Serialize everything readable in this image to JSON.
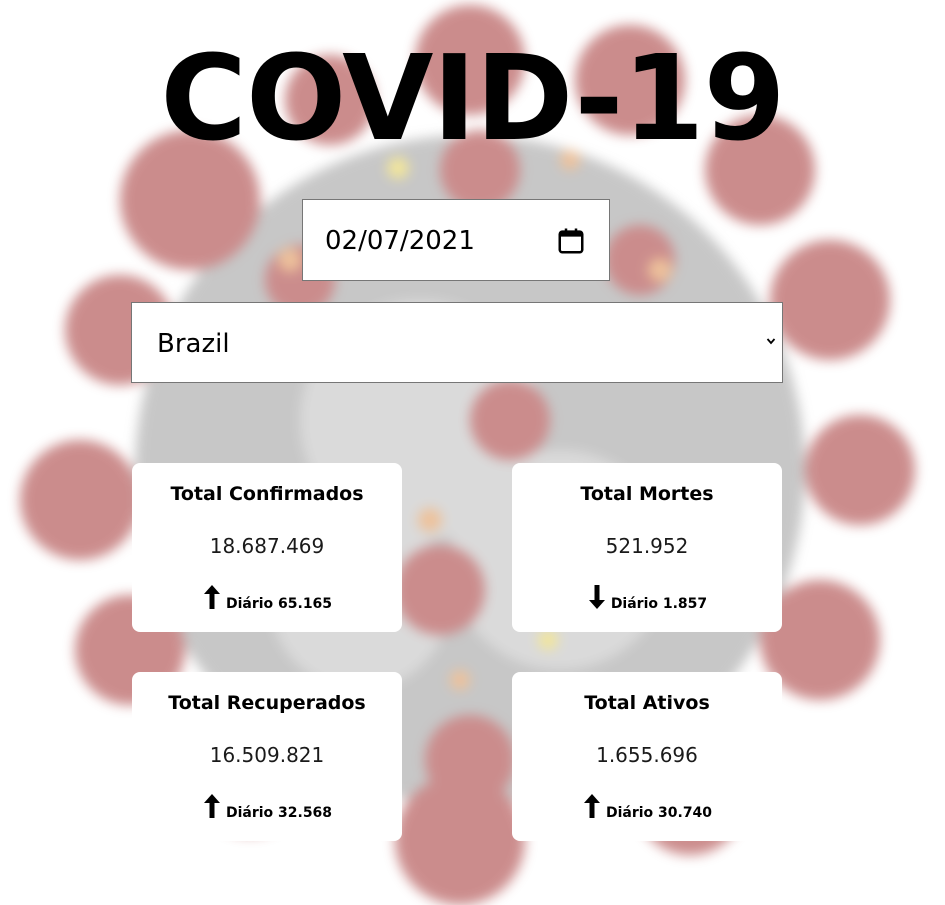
{
  "header": {
    "title": "COVID-19"
  },
  "filters": {
    "date_value": "02/07/2021",
    "country_value": "Brazil"
  },
  "icons": {
    "calendar": "calendar-icon",
    "dropdown": "chevron-down-icon",
    "up": "arrow-up-icon",
    "down": "arrow-down-icon"
  },
  "colors": {
    "card_bg": "#ffffff",
    "text": "#000000",
    "virus_red": "#b13a3a",
    "virus_gray": "#a9a9a9"
  },
  "cards": [
    {
      "title": "Total Confirmados",
      "value": "18.687.469",
      "daily_label": "Diário 65.165",
      "trend": "up"
    },
    {
      "title": "Total Mortes",
      "value": "521.952",
      "daily_label": "Diário 1.857",
      "trend": "down"
    },
    {
      "title": "Total Recuperados",
      "value": "16.509.821",
      "daily_label": "Diário 32.568",
      "trend": "up"
    },
    {
      "title": "Total Ativos",
      "value": "1.655.696",
      "daily_label": "Diário 30.740",
      "trend": "up"
    }
  ]
}
